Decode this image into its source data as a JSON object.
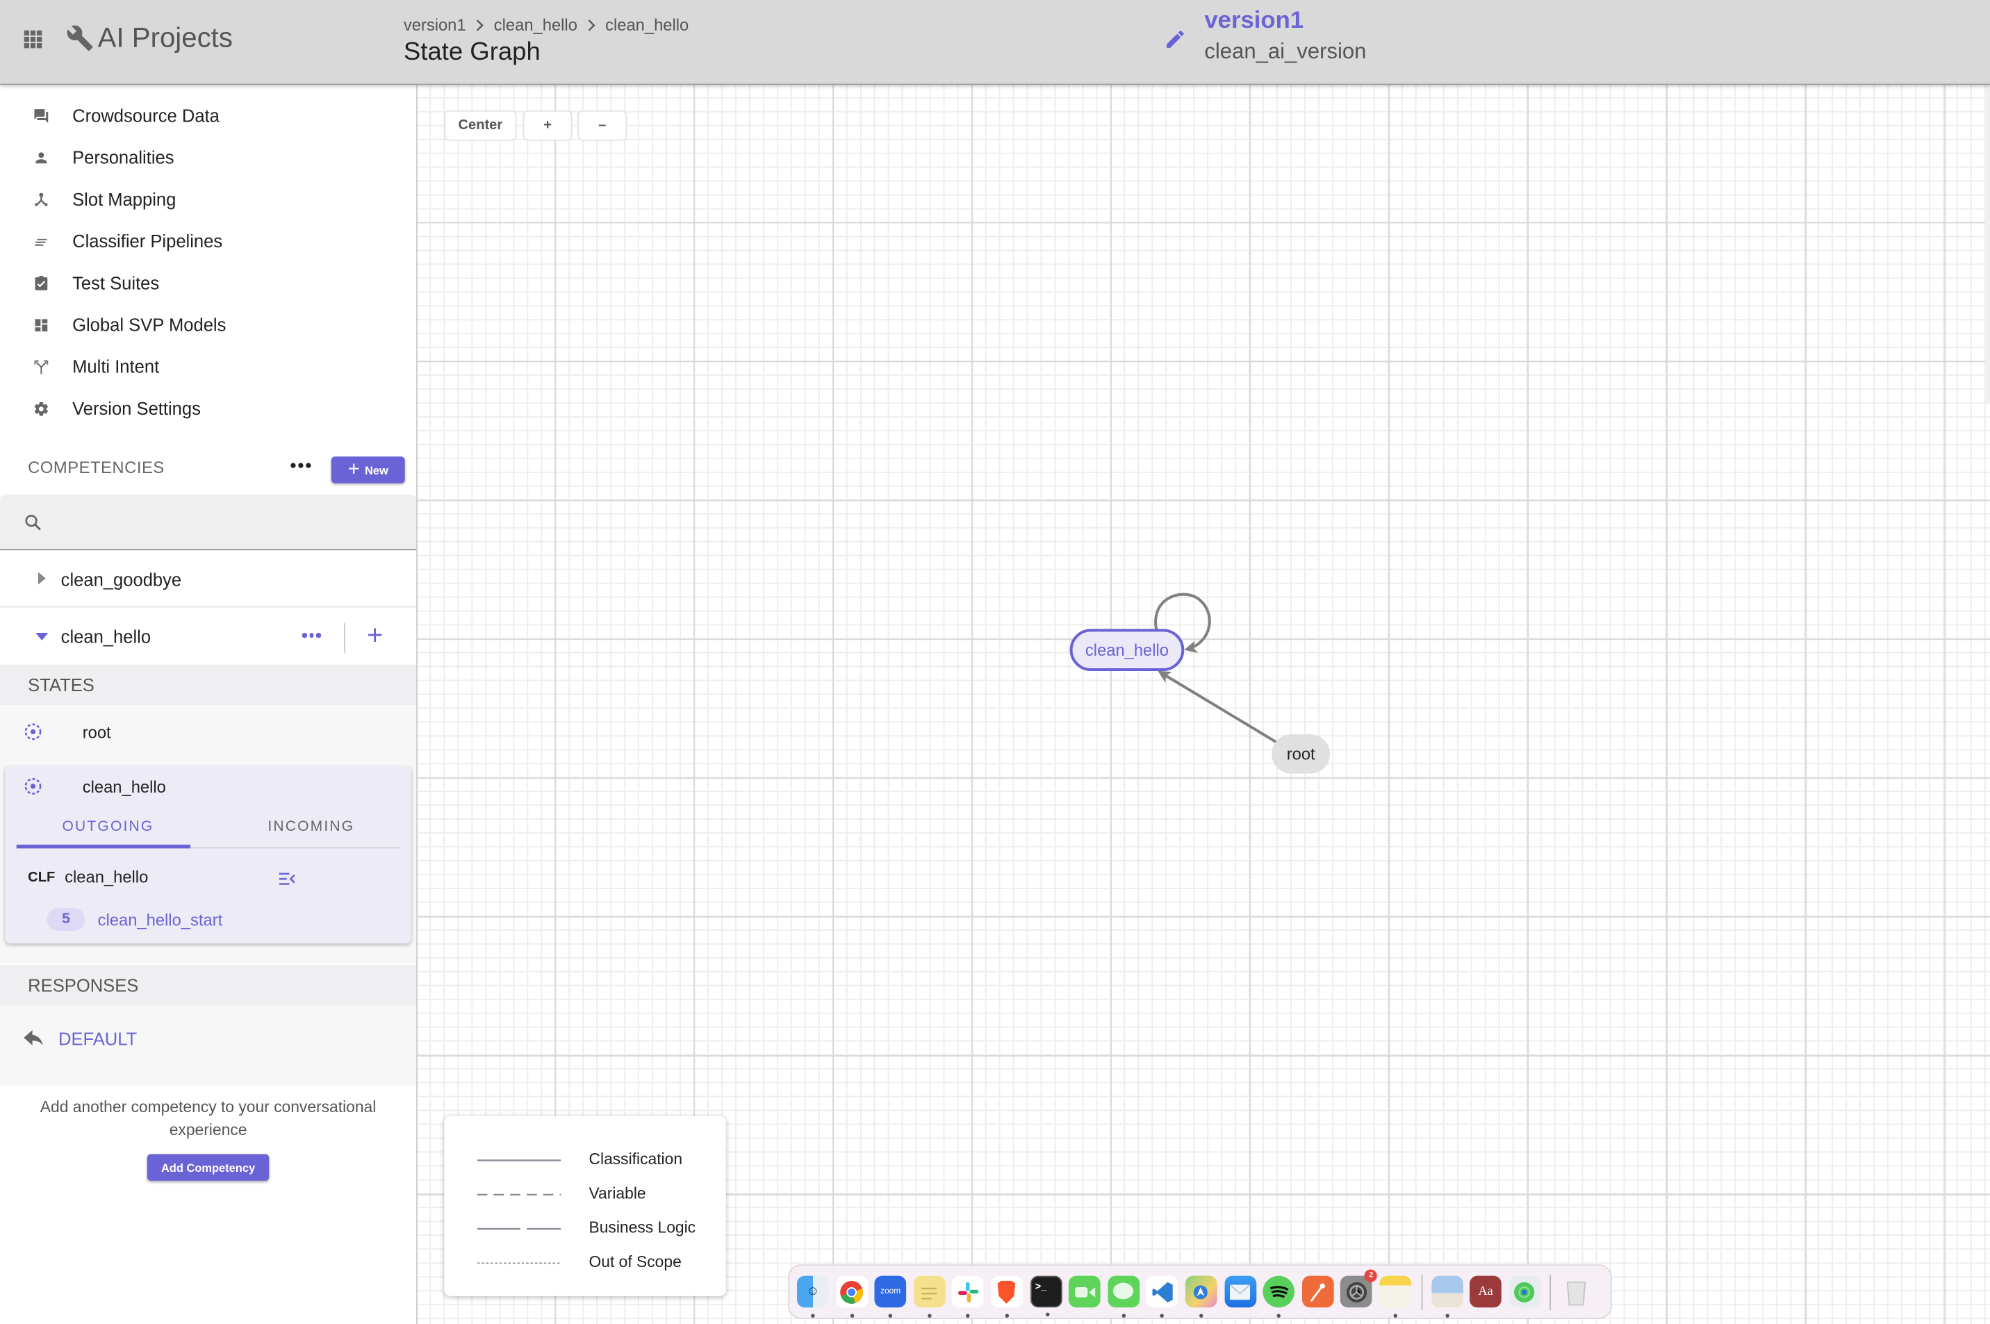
{
  "header": {
    "app_title": "AI Projects",
    "breadcrumb": [
      "version1",
      "clean_hello",
      "clean_hello"
    ],
    "page_title": "State Graph",
    "version_name": "version1",
    "version_subtitle": "clean_ai_version"
  },
  "sidebar": {
    "nav_items": [
      {
        "label": "Crowdsource Data",
        "icon": "forum-icon"
      },
      {
        "label": "Personalities",
        "icon": "person-icon"
      },
      {
        "label": "Slot Mapping",
        "icon": "merge-type-icon"
      },
      {
        "label": "Classifier Pipelines",
        "icon": "short-text-icon"
      },
      {
        "label": "Test Suites",
        "icon": "assignment-check-icon"
      },
      {
        "label": "Global SVP Models",
        "icon": "dashboard-icon"
      },
      {
        "label": "Multi Intent",
        "icon": "call-split-icon"
      },
      {
        "label": "Version Settings",
        "icon": "gear-icon"
      }
    ],
    "competencies_header": "COMPETENCIES",
    "new_button": "New",
    "search": {
      "value": "",
      "placeholder": ""
    },
    "competencies": [
      {
        "label": "clean_goodbye",
        "expanded": false
      },
      {
        "label": "clean_hello",
        "expanded": true
      }
    ],
    "states_header": "STATES",
    "states": [
      {
        "label": "root"
      },
      {
        "label": "clean_hello",
        "selected": true
      }
    ],
    "tabs": {
      "outgoing": "OUTGOING",
      "incoming": "INCOMING",
      "active": "OUTGOING"
    },
    "transition": {
      "type": "CLF",
      "name": "clean_hello",
      "count": "5",
      "intent": "clean_hello_start"
    },
    "responses_header": "RESPONSES",
    "default_response": "DEFAULT",
    "add_text": "Add another competency to your conversational experience",
    "add_button": "Add Competency"
  },
  "canvas": {
    "controls": {
      "center": "Center",
      "zoom_in": "+",
      "zoom_out": "–"
    },
    "nodes": [
      {
        "id": "clean_hello",
        "label": "clean_hello",
        "selected": true
      },
      {
        "id": "root",
        "label": "root",
        "selected": false
      }
    ],
    "edges": [
      {
        "from": "root",
        "to": "clean_hello",
        "type": "Classification"
      },
      {
        "from": "clean_hello",
        "to": "clean_hello",
        "type": "Classification"
      }
    ],
    "legend": [
      {
        "label": "Classification",
        "style": "solid"
      },
      {
        "label": "Variable",
        "style": "dashed"
      },
      {
        "label": "Business Logic",
        "style": "long-dash"
      },
      {
        "label": "Out of Scope",
        "style": "dotted"
      }
    ]
  },
  "colors": {
    "accent": "#6a63d5",
    "header_bg": "#d9d9d9",
    "selected_node_fill": "#ebe9f8",
    "node_fill": "#e0e0e0",
    "edge": "#808080"
  },
  "dock": {
    "apps": [
      {
        "name": "Finder",
        "running": true
      },
      {
        "name": "Chrome",
        "running": true
      },
      {
        "name": "Zoom",
        "label": "zoom",
        "running": true
      },
      {
        "name": "Stickies",
        "running": true
      },
      {
        "name": "Slack",
        "running": true
      },
      {
        "name": "Brave",
        "running": true
      },
      {
        "name": "Terminal",
        "running": true
      },
      {
        "name": "FaceTime",
        "running": false
      },
      {
        "name": "Messages",
        "running": true
      },
      {
        "name": "VS Code",
        "running": true
      },
      {
        "name": "Maps",
        "running": true
      },
      {
        "name": "Mail",
        "running": false
      },
      {
        "name": "Spotify",
        "running": true
      },
      {
        "name": "Postman",
        "running": false
      },
      {
        "name": "System Preferences",
        "badge": "2",
        "running": false
      },
      {
        "name": "Notes",
        "running": true
      },
      {
        "name": "Preview",
        "running": true
      },
      {
        "name": "Dictionary",
        "label": "Aa",
        "running": false
      },
      {
        "name": "Find My",
        "running": false
      },
      {
        "name": "Trash",
        "running": false
      }
    ]
  }
}
